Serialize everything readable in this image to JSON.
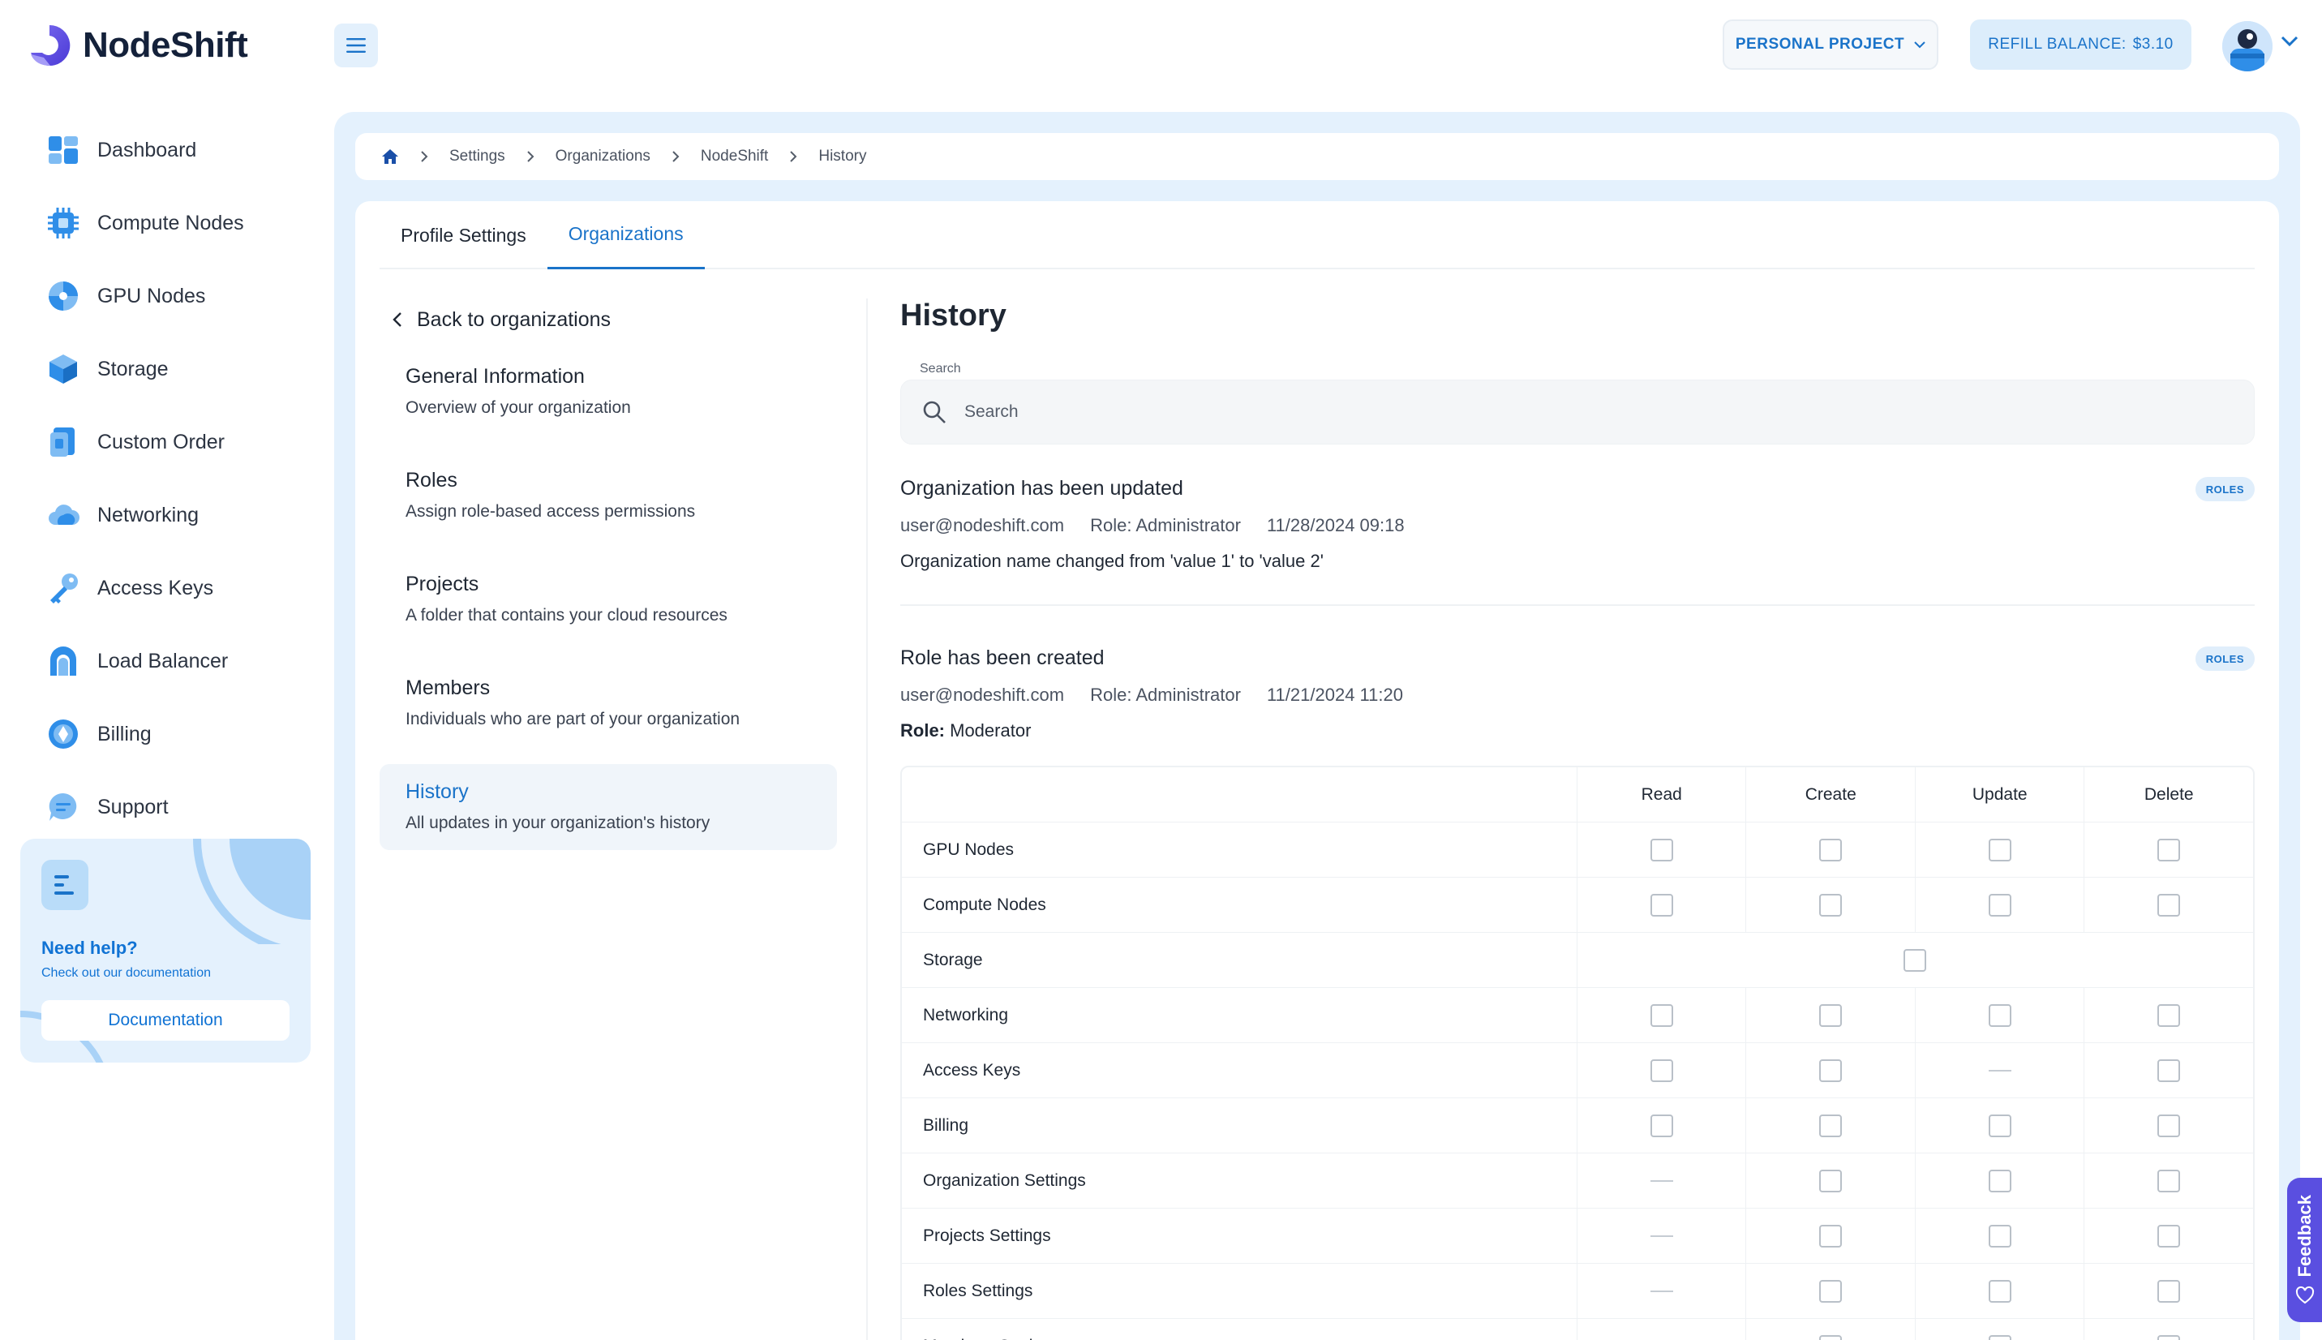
{
  "brand": {
    "name": "NodeShift"
  },
  "sidebar": {
    "items": [
      {
        "label": "Dashboard",
        "icon": "dashboard-icon"
      },
      {
        "label": "Compute Nodes",
        "icon": "cpu-icon"
      },
      {
        "label": "GPU Nodes",
        "icon": "gpu-icon"
      },
      {
        "label": "Storage",
        "icon": "storage-cube-icon"
      },
      {
        "label": "Custom Order",
        "icon": "custom-order-icon"
      },
      {
        "label": "Networking",
        "icon": "cloud-icon"
      },
      {
        "label": "Access Keys",
        "icon": "key-icon"
      },
      {
        "label": "Load Balancer",
        "icon": "load-balancer-icon"
      },
      {
        "label": "Billing",
        "icon": "billing-icon"
      },
      {
        "label": "Support",
        "icon": "support-chat-icon"
      }
    ],
    "help": {
      "title": "Need help?",
      "subtitle": "Check out our documentation",
      "button": "Documentation"
    }
  },
  "header": {
    "project": "PERSONAL PROJECT",
    "refill_label": "REFILL BALANCE:",
    "refill_amount": "$3.10"
  },
  "breadcrumb": [
    "Settings",
    "Organizations",
    "NodeShift",
    "History"
  ],
  "tabs": [
    {
      "label": "Profile Settings",
      "active": false
    },
    {
      "label": "Organizations",
      "active": true
    }
  ],
  "submenu": {
    "back": "Back to organizations",
    "items": [
      {
        "title": "General Information",
        "desc": "Overview of your organization"
      },
      {
        "title": "Roles",
        "desc": "Assign role-based access permissions"
      },
      {
        "title": "Projects",
        "desc": "A folder that contains your cloud resources"
      },
      {
        "title": "Members",
        "desc": "Individuals who are part of your organization"
      },
      {
        "title": "History",
        "desc": "All updates in your organization's history"
      }
    ]
  },
  "history": {
    "title": "History",
    "search_label": "Search",
    "search_placeholder": "Search",
    "events": [
      {
        "title": "Organization has been updated",
        "user": "user@nodeshift.com",
        "role": "Role: Administrator",
        "time": "11/28/2024 09:18",
        "body": "Organization name changed from 'value 1' to 'value 2'",
        "badge": "ROLES"
      },
      {
        "title": "Role has been created",
        "user": "user@nodeshift.com",
        "role": "Role: Administrator",
        "time": "11/21/2024 11:20",
        "role_label": "Role:",
        "role_value": "Moderator",
        "badge": "ROLES"
      }
    ],
    "table": {
      "columns": [
        "Read",
        "Create",
        "Update",
        "Delete"
      ],
      "rows": [
        {
          "name": "GPU Nodes"
        },
        {
          "name": "Compute Nodes"
        },
        {
          "name": "Storage"
        },
        {
          "name": "Networking"
        },
        {
          "name": "Access Keys"
        },
        {
          "name": "Billing"
        },
        {
          "name": "Organization Settings"
        },
        {
          "name": "Projects Settings"
        },
        {
          "name": "Roles Settings"
        },
        {
          "name": "Members Settings"
        }
      ]
    }
  },
  "feedback": {
    "label": "Feedback"
  }
}
